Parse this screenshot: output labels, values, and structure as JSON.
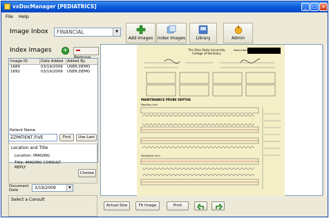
{
  "window": {
    "title": "vxDocManager [PEDIATRICS]"
  },
  "menu": [
    {
      "label": "File"
    },
    {
      "label": "Help"
    }
  ],
  "toolbar": {
    "inbox_label": "Image Inbox",
    "inbox_value": "FINANCIAL",
    "add_images": "Add Images",
    "index_images": "Index Images",
    "library": "Library",
    "admin": "Admin"
  },
  "index_panel": {
    "title": "Index Images",
    "remove_label": "Remove",
    "columns": [
      "Image ID",
      "Date Added",
      "Added By"
    ],
    "rows": [
      {
        "id": "1689",
        "date": "03/19/2009",
        "by": "USER,DEMO"
      },
      {
        "id": "1692",
        "date": "03/19/2009",
        "by": "USER,DEMO"
      }
    ]
  },
  "patient": {
    "label": "Patient Name",
    "value": "ZZPATIENT,FIVE",
    "find": "Find",
    "use_last": "Use Last"
  },
  "location_title": {
    "heading": "Location and Title",
    "location": "Location: IMAGING",
    "title_line1": "Title: IMAGING CONSULT",
    "title_line2": "REPLY",
    "choose": "Choose"
  },
  "document_date": {
    "label": "Document Date",
    "value": "3/19/2009"
  },
  "consult": {
    "heading": "Select a Consult"
  },
  "viewer": {
    "document": {
      "university": "The Ohio State University",
      "college": "College of Dentistry",
      "patient_name_label": "Patient Name",
      "section_title": "MAINTENANCE PROBE DEPTHS",
      "maxillary_label": "Maxillary Arch",
      "mandibular_label": "Mandibular Arch"
    },
    "buttons": {
      "actual_size": "Actual Size",
      "fit_image": "Fit Image",
      "print": "Print"
    }
  },
  "colors": {
    "titlebar": "#0a5ad8",
    "panel": "#ece9d8",
    "document": "#f5efc8",
    "accent_green": "#2e9a2e",
    "remove_red": "#c01818"
  }
}
